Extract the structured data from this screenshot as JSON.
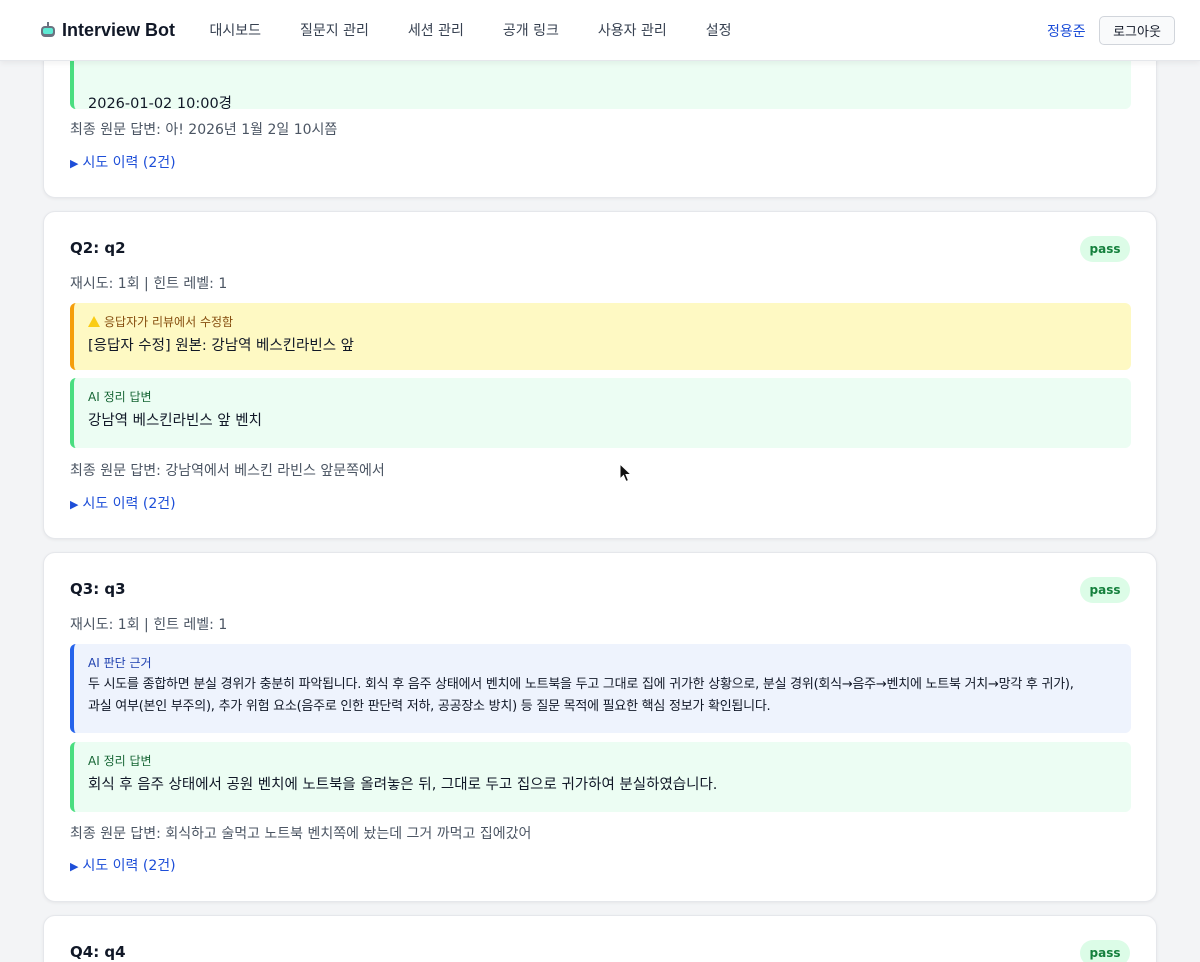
{
  "header": {
    "brand": "Interview Bot",
    "nav": [
      "대시보드",
      "질문지 관리",
      "세션 관리",
      "공개 링크",
      "사용자 관리",
      "설정"
    ],
    "user_name": "정용준",
    "logout_label": "로그아웃"
  },
  "q1_partial": {
    "ai_answer": "2026-01-02 10:00경",
    "raw_answer": "최종 원문 답변: 아! 2026년 1월 2일 10시쯤",
    "history": "시도 이력 (2건)"
  },
  "q2": {
    "title": "Q2: q2",
    "status": "pass",
    "meta": "재시도: 1회 | 힌트 레벨: 1",
    "edit_label": "응답자가 리뷰에서 수정함",
    "edit_text": "[응답자 수정] 원본: 강남역 베스킨라빈스 앞",
    "ai_label": "AI 정리 답변",
    "ai_answer": "강남역 베스킨라빈스 앞 벤치",
    "raw_answer": "최종 원문 답변: 강남역에서 베스킨 라빈스 앞문쪽에서",
    "history": "시도 이력 (2건)"
  },
  "q3": {
    "title": "Q3: q3",
    "status": "pass",
    "meta": "재시도: 1회 | 힌트 레벨: 1",
    "reason_label": "AI 판단 근거",
    "reason_line1": "두 시도를 종합하면 분실 경위가 충분히 파악됩니다. 회식 후 음주 상태에서 벤치에 노트북을 두고 그대로 집에 귀가한 상황으로, 분실 경위(회식→음주→벤치에 노트북 거치→망각 후 귀가),",
    "reason_line2": "과실 여부(본인 부주의), 추가 위험 요소(음주로 인한 판단력 저하, 공공장소 방치) 등 질문 목적에 필요한 핵심 정보가 확인됩니다.",
    "ai_label": "AI 정리 답변",
    "ai_answer": "회식 후 음주 상태에서 공원 벤치에 노트북을 올려놓은 뒤, 그대로 두고 집으로 귀가하여 분실하였습니다.",
    "raw_answer": "최종 원문 답변: 회식하고 술먹고 노트북 벤치쪽에 놨는데 그거 까먹고 집에갔어",
    "history": "시도 이력 (2건)"
  },
  "q4": {
    "title": "Q4: q4",
    "status": "pass"
  },
  "colors": {
    "link": "#1d4ed8",
    "pass_bg": "#dcfce7",
    "pass_text": "#15803d",
    "green_accent": "#4ade80",
    "yellow_accent": "#f59e0b",
    "blue_accent": "#2563eb"
  }
}
